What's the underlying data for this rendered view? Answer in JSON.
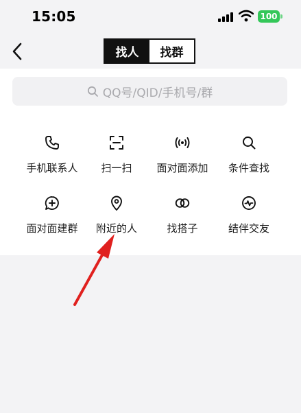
{
  "status_bar": {
    "time": "15:05",
    "battery": "100"
  },
  "nav": {
    "back_icon": "chevron-left-icon",
    "tabs": [
      "找人",
      "找群"
    ],
    "active_tab": 0
  },
  "search": {
    "placeholder": "QQ号/QID/手机号/群",
    "icon": "search-icon"
  },
  "actions": [
    {
      "label": "手机联系人",
      "icon": "phone-icon"
    },
    {
      "label": "扫一扫",
      "icon": "scan-icon"
    },
    {
      "label": "面对面添加",
      "icon": "nearby-signal-icon"
    },
    {
      "label": "条件查找",
      "icon": "search-icon"
    },
    {
      "label": "面对面建群",
      "icon": "chat-plus-icon"
    },
    {
      "label": "附近的人",
      "icon": "location-pin-icon"
    },
    {
      "label": "找搭子",
      "icon": "link-rings-icon"
    },
    {
      "label": "结伴交友",
      "icon": "heartbeat-icon"
    }
  ],
  "colors": {
    "panel": "#ffffff",
    "background": "#f3f3f5",
    "battery": "#34c759",
    "arrow": "#e0201e"
  }
}
